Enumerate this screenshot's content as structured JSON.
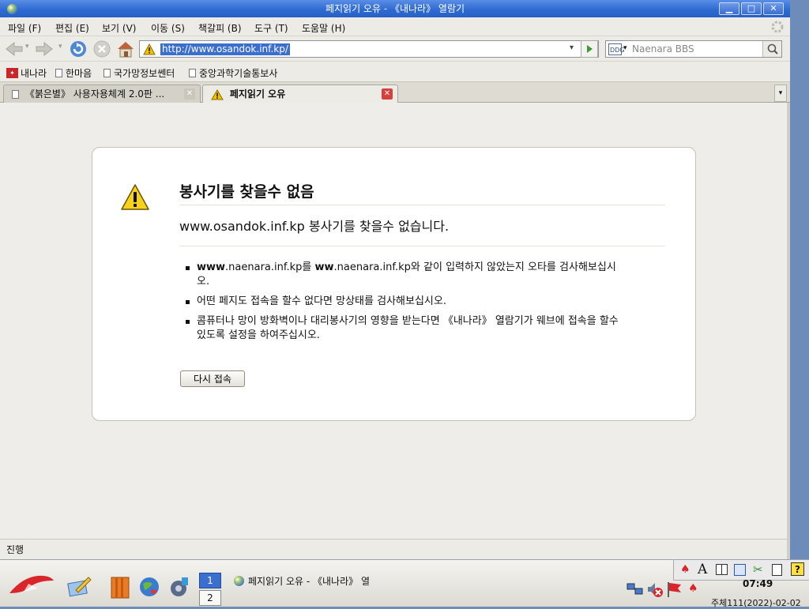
{
  "window": {
    "title": "페지읽기 오유 - 《내나라》 열람기"
  },
  "menu": [
    "파일 (F)",
    "편집 (E)",
    "보기 (V)",
    "이동 (S)",
    "책갈피 (B)",
    "도구 (T)",
    "도움말 (H)"
  ],
  "address": {
    "url": "http://www.osandok.inf.kp/",
    "search_placeholder": "Naenara BBS"
  },
  "bookmarks": [
    "내나라",
    "한마음",
    "국가망정보쎈터",
    "중앙과학기술통보사"
  ],
  "tabs": [
    {
      "label": "《붉은별》 사용자용체계 2.0판 ...",
      "active": false
    },
    {
      "label": "페지읽기 오유",
      "active": true
    }
  ],
  "error": {
    "title": "봉사기를 찾을수 없음",
    "subtitle": "www.osandok.inf.kp 봉사기를 찾을수 없습니다.",
    "item1_bold1": "www",
    "item1_a": ".naenara.inf.kp를 ",
    "item1_bold2": "ww",
    "item1_b": ".naenara.inf.kp와 같이 입력하지 않았는지 오타를 검사해보십시오.",
    "item2": "어떤 페지도 접속을 할수 없다면 망상태를 검사해보십시오.",
    "item3": "콤퓨터나 망이 방화벽이나 대리봉사기의 영향을 받는다면 《내나라》 열람기가 웨브에 접속을 할수 있도록 설정을 하여주십시오.",
    "retry_label": "다시 접속"
  },
  "status": {
    "text": "진행"
  },
  "taskbar": {
    "workspace_1": "1",
    "workspace_2": "2",
    "task_label": "페지읽기 오유 - 《내나라》 열",
    "clock": "07:49",
    "date": "주체111(2022)-02-02"
  },
  "colors": {
    "titlebar": "#2f6bd2",
    "selection": "#3a6fd0",
    "warning": "#f2c200",
    "close_tab": "#d8403d"
  }
}
